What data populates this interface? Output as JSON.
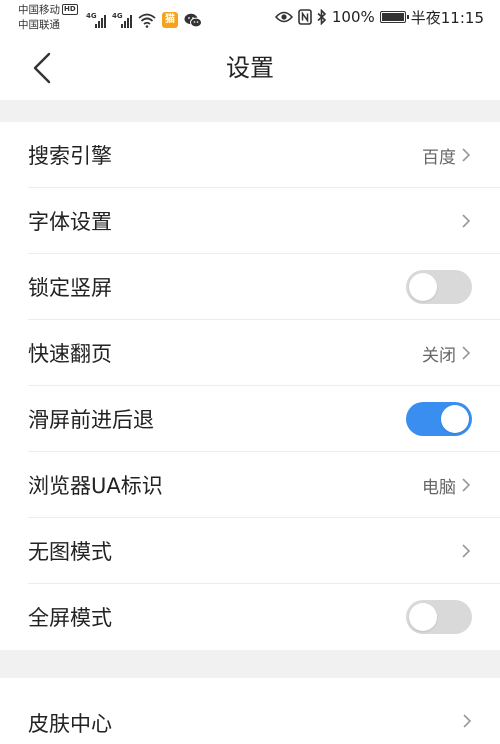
{
  "status_bar": {
    "carrier1": "中国移动",
    "hd_badge": "HD",
    "carrier2": "中国联通",
    "network1": "4G",
    "network2": "4G",
    "app_badge": "猫",
    "battery_text": "100%",
    "time": "半夜11:15",
    "battery_level": 1.0,
    "icons": [
      "wifi-icon",
      "app-notification-icon",
      "wechat-icon",
      "eye-icon",
      "nfc-icon",
      "bluetooth-icon",
      "battery-icon"
    ]
  },
  "header": {
    "back_icon": "chevron-left-icon",
    "title": "设置"
  },
  "settings": {
    "items": [
      {
        "label": "搜索引擎",
        "value": "百度",
        "type": "link"
      },
      {
        "label": "字体设置",
        "value": "",
        "type": "link"
      },
      {
        "label": "锁定竖屏",
        "type": "toggle",
        "state": "off"
      },
      {
        "label": "快速翻页",
        "value": "关闭",
        "type": "link"
      },
      {
        "label": "滑屏前进后退",
        "type": "toggle",
        "state": "on"
      },
      {
        "label": "浏览器UA标识",
        "value": "电脑",
        "type": "link"
      },
      {
        "label": "无图模式",
        "value": "",
        "type": "link"
      },
      {
        "label": "全屏模式",
        "type": "toggle",
        "state": "off"
      }
    ],
    "next_section_item": {
      "label": "皮肤中心",
      "type": "link"
    }
  },
  "colors": {
    "accent": "#3a8ef0",
    "toggle_off": "#d9d9d9",
    "section_gap": "#f1f1f1",
    "text_primary": "#222222",
    "text_secondary": "#666666"
  }
}
